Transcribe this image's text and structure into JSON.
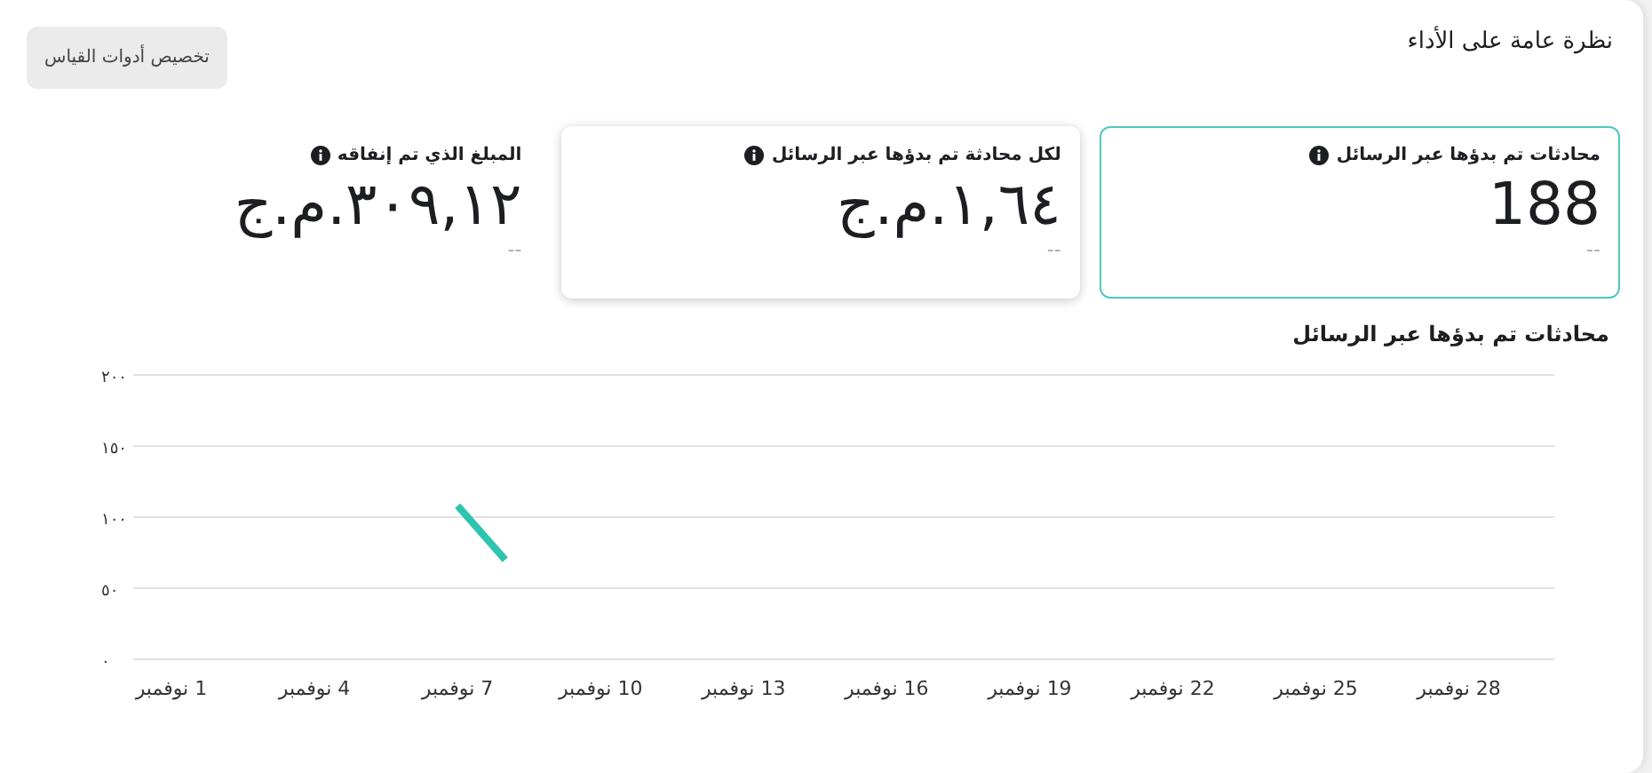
{
  "title": "نظرة عامة على الأداء",
  "customize_button": "تخصيص أدوات القياس",
  "metric_cards": [
    {
      "label": "محادثات تم بدؤها عبر الرسائل",
      "value": "188",
      "comparison": "--",
      "selected": true,
      "elevated": false
    },
    {
      "label": "لكل محادثة تم بدؤها عبر الرسائل",
      "value": "ج.م.١,٦٤",
      "comparison": "--",
      "selected": false,
      "elevated": true
    },
    {
      "label": "المبلغ الذي تم إنفاقه",
      "value": "ج.م.٣٠٩,١٢",
      "comparison": "--",
      "selected": false,
      "elevated": false
    }
  ],
  "chart": {
    "title": "محادثات تم بدؤها عبر الرسائل",
    "chart_data": {
      "type": "line",
      "x": [
        7,
        8
      ],
      "series": [
        {
          "color": "#2ec4b0",
          "values": [
            108,
            70
          ]
        }
      ],
      "grid": true,
      "xlim": [
        0.2,
        30
      ],
      "ylim": [
        0,
        200
      ],
      "xticks": [
        {
          "value": 1,
          "label": "1 نوفمبر"
        },
        {
          "value": 4,
          "label": "4 نوفمبر"
        },
        {
          "value": 7,
          "label": "7 نوفمبر"
        },
        {
          "value": 10,
          "label": "10 نوفمبر"
        },
        {
          "value": 13,
          "label": "13 نوفمبر"
        },
        {
          "value": 16,
          "label": "16 نوفمبر"
        },
        {
          "value": 19,
          "label": "19 نوفمبر"
        },
        {
          "value": 22,
          "label": "22 نوفمبر"
        },
        {
          "value": 25,
          "label": "25 نوفمبر"
        },
        {
          "value": 28,
          "label": "28 نوفمبر"
        }
      ],
      "yticks": [
        {
          "value": 200,
          "label": "٢٠٠"
        },
        {
          "value": 150,
          "label": "١٥٠"
        },
        {
          "value": 100,
          "label": "١٠٠"
        },
        {
          "value": 50,
          "label": "٥٠"
        },
        {
          "value": 0,
          "label": "٠"
        }
      ]
    }
  }
}
